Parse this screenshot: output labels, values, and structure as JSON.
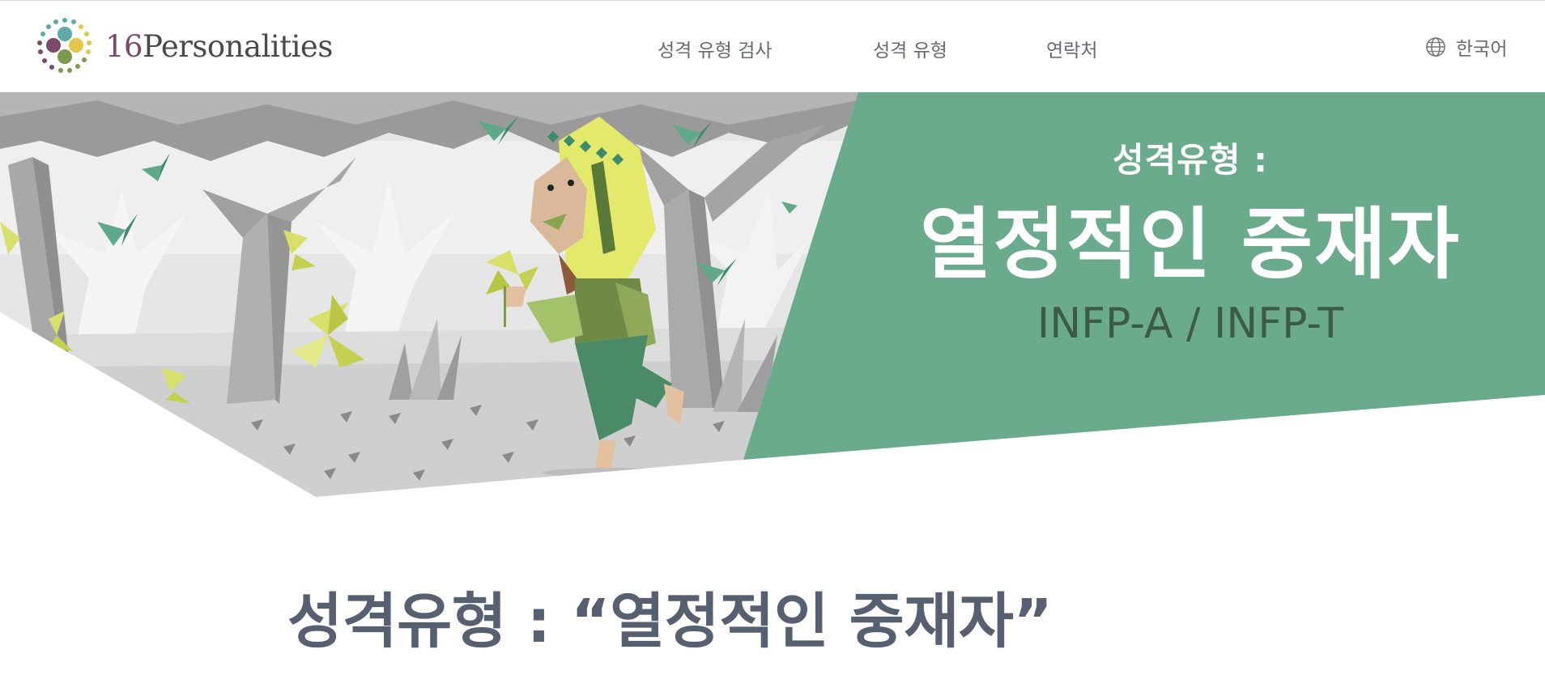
{
  "logo": {
    "num": "16",
    "word": "Personalities"
  },
  "nav": {
    "items": [
      {
        "label": "성격 유형 검사"
      },
      {
        "label": "성격 유형"
      },
      {
        "label": "연락처"
      }
    ],
    "language": "한국어",
    "language_icon": "globe-icon"
  },
  "hero": {
    "kicker": "성격유형 :",
    "title": "열정적인 중재자",
    "code": "INFP-A / INFP-T",
    "illustration": "mediator-character-in-grey-forest",
    "panel_color": "#6aab8e"
  },
  "main": {
    "heading": "성격유형 : “열정적인 중재자”"
  },
  "colors": {
    "text_dark": "#576071",
    "nav_text": "#666b73",
    "accent_green": "#6aab8e",
    "code_text": "#3d5a47"
  }
}
